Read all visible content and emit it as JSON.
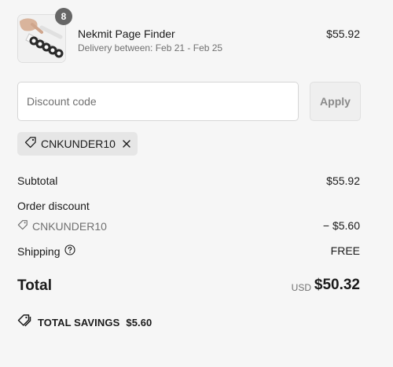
{
  "product": {
    "name": "Nekmit Page Finder",
    "delivery": "Delivery between: Feb 21 - Feb 25",
    "price": "$55.92",
    "quantity": "8",
    "image_icon": "product-thumbnail-image"
  },
  "discount": {
    "placeholder": "Discount code",
    "value": "",
    "apply_label": "Apply",
    "applied_code": "CNKUNDER10"
  },
  "summary": {
    "subtotal_label": "Subtotal",
    "subtotal_value": "$55.92",
    "order_discount_label": "Order discount",
    "discount_code": "CNKUNDER10",
    "discount_value": "− $5.60",
    "shipping_label": "Shipping",
    "shipping_value": "FREE",
    "total_label": "Total",
    "currency": "USD",
    "total_value": "$50.32",
    "savings_label": "TOTAL SAVINGS",
    "savings_value": "$5.60"
  },
  "colors": {
    "background": "#f6f6f6",
    "text": "#1a1a1a",
    "muted_text": "#707070",
    "badge": "#666666",
    "chip": "#e6e6e6"
  }
}
